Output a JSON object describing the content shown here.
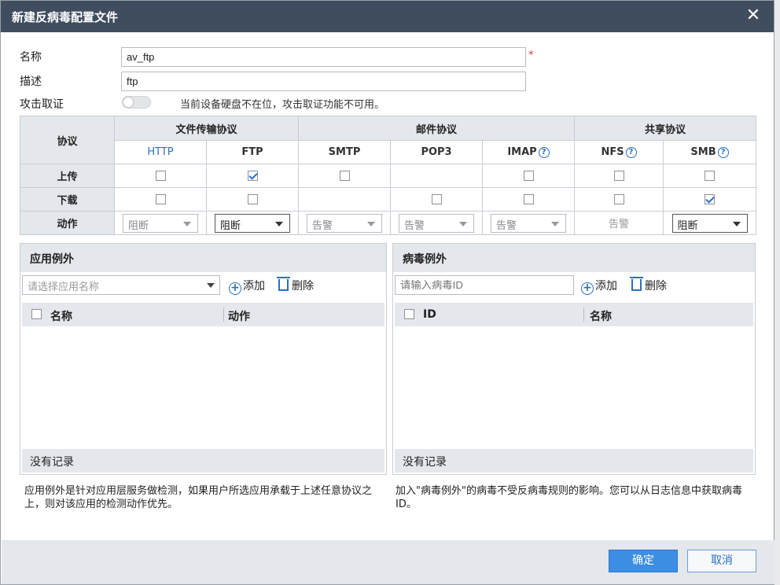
{
  "dialog": {
    "title": "新建反病毒配置文件",
    "close_label": "✕"
  },
  "form": {
    "name_label": "名称",
    "name_value": "av_ftp",
    "required_mark": "*",
    "desc_label": "描述",
    "desc_value": "ftp",
    "forensics_label": "攻击取证",
    "forensics_enabled": false,
    "forensics_hint": "当前设备硬盘不在位，攻击取证功能不可用。"
  },
  "protocol_table": {
    "protocol_header": "协议",
    "groups": [
      "文件传输协议",
      "邮件协议",
      "共享协议"
    ],
    "protocols": [
      "HTTP",
      "FTP",
      "SMTP",
      "POP3",
      "IMAP",
      "NFS",
      "SMB"
    ],
    "help_mark": "?",
    "upload_label": "上传",
    "download_label": "下载",
    "action_label": "动作",
    "actions": [
      "阻断",
      "阻断",
      "告警",
      "告警",
      "告警",
      "告警",
      "阻断"
    ]
  },
  "app_exception": {
    "title": "应用例外",
    "placeholder": "请选择应用名称",
    "add_label": "添加",
    "delete_label": "删除",
    "col_name": "名称",
    "col_action": "动作",
    "empty": "没有记录",
    "note": "应用例外是针对应用层服务做检测，如果用户所选应用承载于上述任意协议之上，则对该应用的检测动作优先。"
  },
  "virus_exception": {
    "title": "病毒例外",
    "placeholder": "请输入病毒ID",
    "add_label": "添加",
    "delete_label": "删除",
    "col_id": "ID",
    "col_name": "名称",
    "empty": "没有记录",
    "note": "加入\"病毒例外\"的病毒不受反病毒规则的影响。您可以从日志信息中获取病毒ID。"
  },
  "footer": {
    "ok_label": "确定",
    "cancel_label": "取消"
  },
  "colors": {
    "titlebar": "#3f4d5f",
    "accent": "#2b6fc2",
    "primary_button": "#3c8ee4",
    "required": "#e03030"
  }
}
